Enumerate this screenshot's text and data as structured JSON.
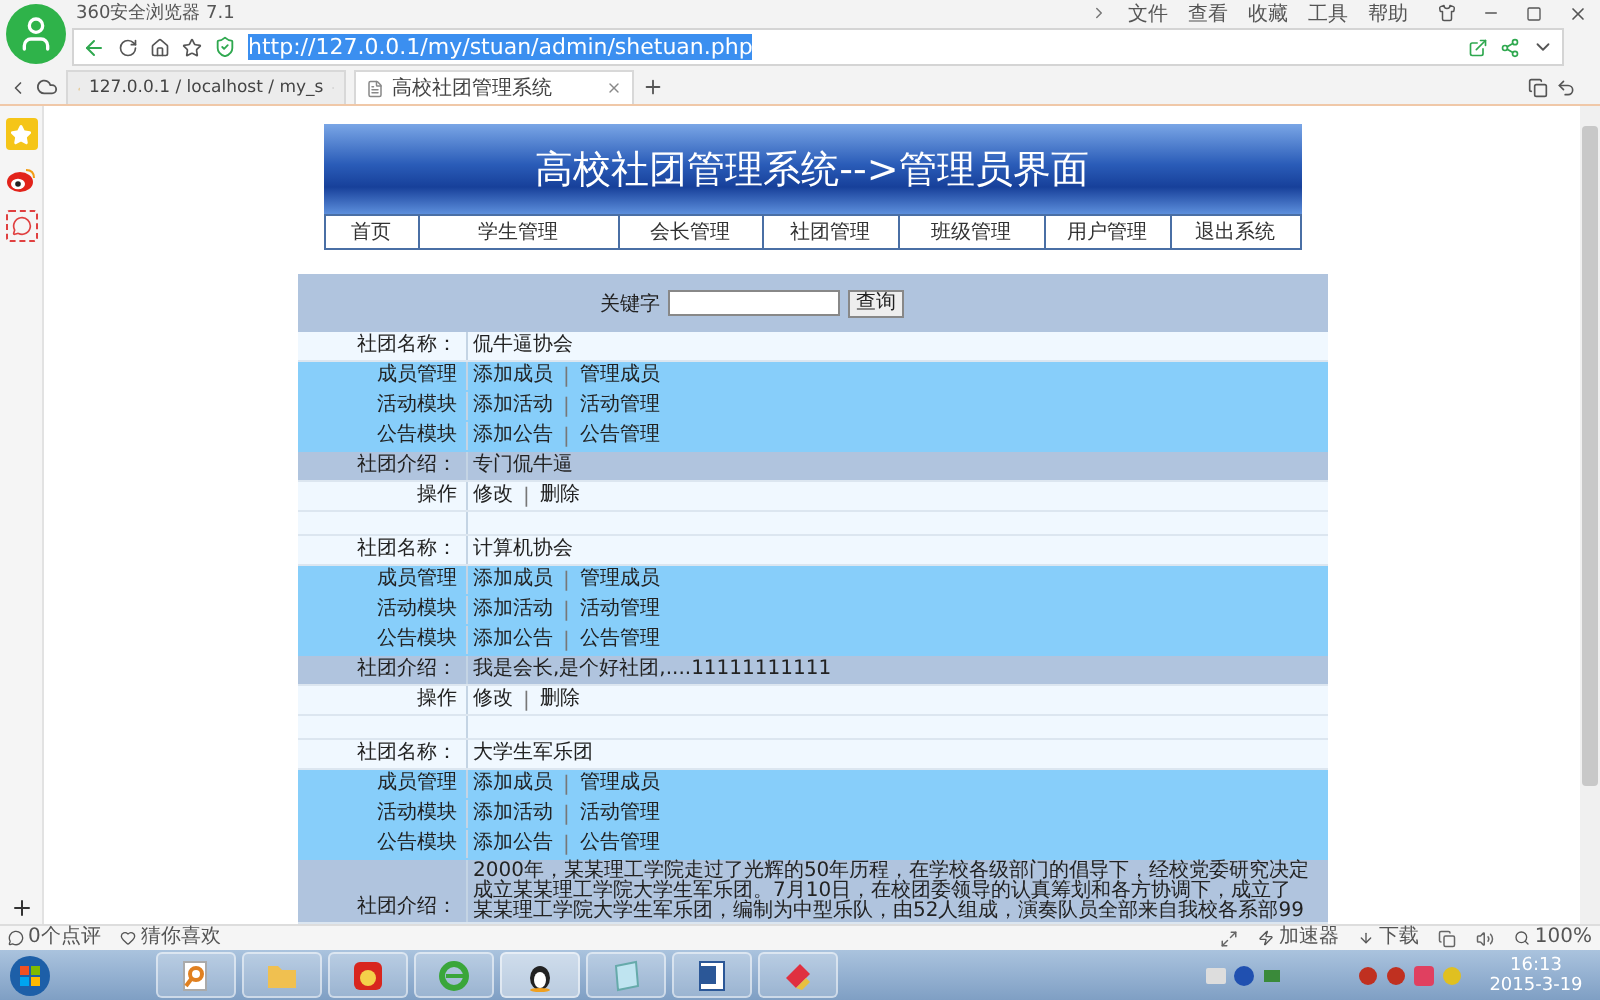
{
  "browser": {
    "title": "360安全浏览器 7.1",
    "menu": [
      "文件",
      "查看",
      "收藏",
      "工具",
      "帮助"
    ],
    "url": "http://127.0.0.1/my/stuan/admin/shetuan.php",
    "url_highlighted": true,
    "tabs": [
      {
        "label": "127.0.0.1 / localhost / my_s",
        "selected": false
      },
      {
        "label": "高校社团管理系统",
        "selected": true
      }
    ]
  },
  "page": {
    "title": "高校社团管理系统-->管理员界面",
    "nav": [
      "首页",
      "学生管理",
      "会长管理",
      "社团管理",
      "班级管理",
      "用户管理",
      "退出系统"
    ],
    "search": {
      "label": "关键字",
      "button": "查询"
    },
    "clubs": [
      {
        "rows": [
          {
            "kind": "name",
            "label": "社团名称：",
            "value": "侃牛逼协会"
          },
          {
            "kind": "module",
            "label": "成员管理",
            "links": [
              "添加成员",
              "管理成员"
            ],
            "separator": "|"
          },
          {
            "kind": "module",
            "label": "活动模块",
            "links": [
              "添加活动",
              "活动管理"
            ],
            "separator": "|"
          },
          {
            "kind": "module",
            "label": "公告模块",
            "links": [
              "添加公告",
              "公告管理"
            ],
            "separator": "|"
          },
          {
            "kind": "intro",
            "label": "社团介绍：",
            "lines": [
              "专门侃牛逼"
            ]
          },
          {
            "kind": "ops",
            "label": "操作",
            "links": [
              "修改",
              "删除"
            ],
            "separator": "|"
          }
        ]
      },
      {
        "rows": [
          {
            "kind": "name",
            "label": "社团名称：",
            "value": "计算机协会"
          },
          {
            "kind": "module",
            "label": "成员管理",
            "links": [
              "添加成员",
              "管理成员"
            ],
            "separator": "|"
          },
          {
            "kind": "module",
            "label": "活动模块",
            "links": [
              "添加活动",
              "活动管理"
            ],
            "separator": "|"
          },
          {
            "kind": "module",
            "label": "公告模块",
            "links": [
              "添加公告",
              "公告管理"
            ],
            "separator": "|"
          },
          {
            "kind": "intro",
            "label": "社团介绍：",
            "lines": [
              "我是会长,是个好社团,....11111111111"
            ]
          },
          {
            "kind": "ops",
            "label": "操作",
            "links": [
              "修改",
              "删除"
            ],
            "separator": "|"
          }
        ]
      },
      {
        "rows": [
          {
            "kind": "name",
            "label": "社团名称：",
            "value": "大学生军乐团"
          },
          {
            "kind": "module",
            "label": "成员管理",
            "links": [
              "添加成员",
              "管理成员"
            ],
            "separator": "|"
          },
          {
            "kind": "module",
            "label": "活动模块",
            "links": [
              "添加活动",
              "活动管理"
            ],
            "separator": "|"
          },
          {
            "kind": "module",
            "label": "公告模块",
            "links": [
              "添加公告",
              "公告管理"
            ],
            "separator": "|"
          },
          {
            "kind": "intro",
            "label": "社团介绍：",
            "lines": [
              "2000年，某某理工学院走过了光辉的50年历程，在学校各级部门的倡导下，经校党委研究决定",
              "成立某某理工学院大学生军乐团。7月10日，在校团委领导的认真筹划和各方协调下，成立了",
              "某某理工学院大学生军乐团，编制为中型乐队，由52人组成，演奏队员全部来自我校各系部99"
            ]
          }
        ]
      }
    ]
  },
  "status_bar": {
    "left": [
      "0个点评",
      "猜你喜欢"
    ],
    "accelerator": "加速器",
    "downloads": "下载",
    "zoom": "100%"
  },
  "taskbar": {
    "time": "16:13",
    "date": "2015-3-19"
  }
}
